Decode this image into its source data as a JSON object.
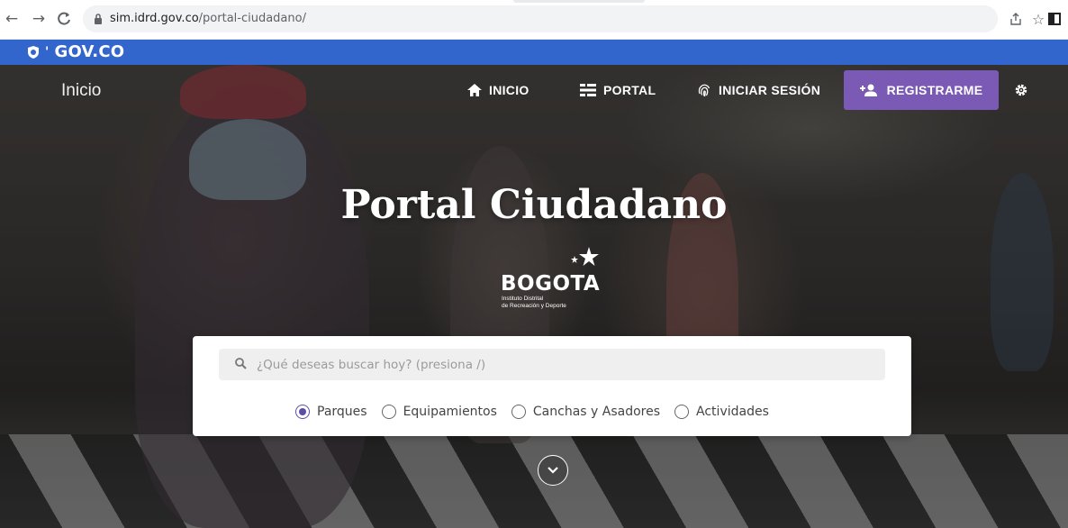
{
  "browser": {
    "url_host": "sim.idrd.gov.co",
    "url_path": "/portal-ciudadano/",
    "back_icon": "arrow-left-icon",
    "forward_icon": "arrow-right-icon",
    "reload_icon": "reload-icon",
    "lock_icon": "lock-icon",
    "share_icon": "share-icon",
    "star_icon": "star-icon",
    "window_icon": "window-icon"
  },
  "govbar": {
    "logo_text": "GOV.CO"
  },
  "header": {
    "site_title": "Inicio",
    "nav": [
      {
        "label": "INICIO",
        "icon": "home-icon"
      },
      {
        "label": "PORTAL",
        "icon": "list-icon"
      },
      {
        "label": "INICIAR SESIÓN",
        "icon": "fingerprint-icon"
      }
    ],
    "register_label": "REGISTRARME",
    "register_icon": "add-user-icon",
    "settings_icon": "gear-icon"
  },
  "hero": {
    "title": "Portal Ciudadano",
    "logo": {
      "word": "BOGOTA",
      "line1": "Instituto Distrital",
      "line2": "de Recreación y Deporte"
    }
  },
  "search": {
    "placeholder": "¿Qué deseas buscar hoy? (presiona /)",
    "value": "",
    "options": [
      {
        "label": "Parques",
        "checked": true
      },
      {
        "label": "Equipamientos",
        "checked": false
      },
      {
        "label": "Canchas y Asadores",
        "checked": false
      },
      {
        "label": "Actividades",
        "checked": false
      }
    ]
  },
  "colors": {
    "gov_blue": "#3366cc",
    "register_purple": "#7a5ab5",
    "radio_accent": "#5a4ea8"
  }
}
